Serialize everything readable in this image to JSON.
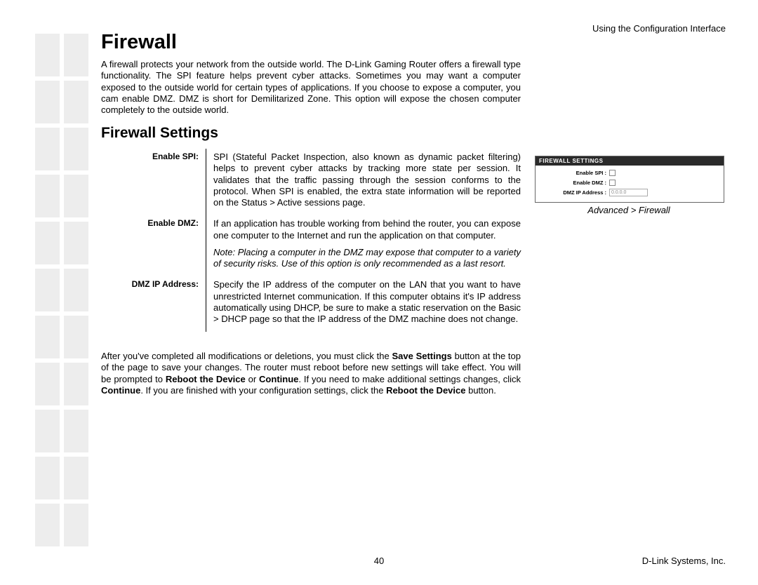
{
  "header": {
    "right": "Using the Configuration Interface"
  },
  "title": "Firewall",
  "intro": "A firewall protects your network from the outside world. The D-Link Gaming Router offers a firewall type functionality. The SPI feature helps prevent cyber attacks. Sometimes you may want a computer exposed to the outside world for certain types of applications. If you choose to expose a computer, you cam enable DMZ. DMZ is short for Demilitarized Zone. This option will expose the chosen computer completely to the outside world.",
  "subtitle": "Firewall Settings",
  "settings": {
    "spi": {
      "label": "Enable SPI:",
      "desc": "SPI (Stateful Packet Inspection, also known as dynamic packet filtering) helps to prevent cyber attacks by tracking more state per session. It validates that the traffic passing through the session conforms to the protocol. When SPI is enabled, the extra state information will be reported on the Status > Active sessions page."
    },
    "dmz": {
      "label": "Enable DMZ:",
      "desc": "If an application has trouble working from behind the router, you can expose one computer to the Internet and run the application on that computer.",
      "note": "Note: Placing a computer in the DMZ may expose that computer to a variety of security risks. Use of this option is only recommended as a last resort."
    },
    "ip": {
      "label": "DMZ IP Address:",
      "desc": "Specify the IP address of the computer on the LAN that you want to have unrestricted Internet communication. If this computer obtains it's IP address automatically using DHCP, be sure to make a static reservation on the Basic > DHCP page so that the IP address of the DMZ machine does not change."
    }
  },
  "outro": {
    "p1a": "After you've completed all modifications or deletions, you must click the ",
    "p1b": "Save Settings",
    "p1c": " button at the top of the page to save your changes. The router must reboot before new settings will take effect. You will be prompted to ",
    "p1d": "Reboot the Device",
    "p1e": " or ",
    "p1f": "Continue",
    "p1g": ". If you need to make additional settings changes, click ",
    "p1h": "Continue",
    "p1i": ". If you are finished with your configuration settings, click the ",
    "p1j": "Reboot the Device",
    "p1k": " button."
  },
  "panel": {
    "title": "FIREWALL SETTINGS",
    "spi_label": "Enable SPI :",
    "dmz_label": "Enable DMZ :",
    "ip_label": "DMZ IP Address :",
    "ip_value": "0.0.0.0"
  },
  "caption": "Advanced > Firewall",
  "footer": {
    "page": "40",
    "company": "D-Link Systems, Inc."
  }
}
